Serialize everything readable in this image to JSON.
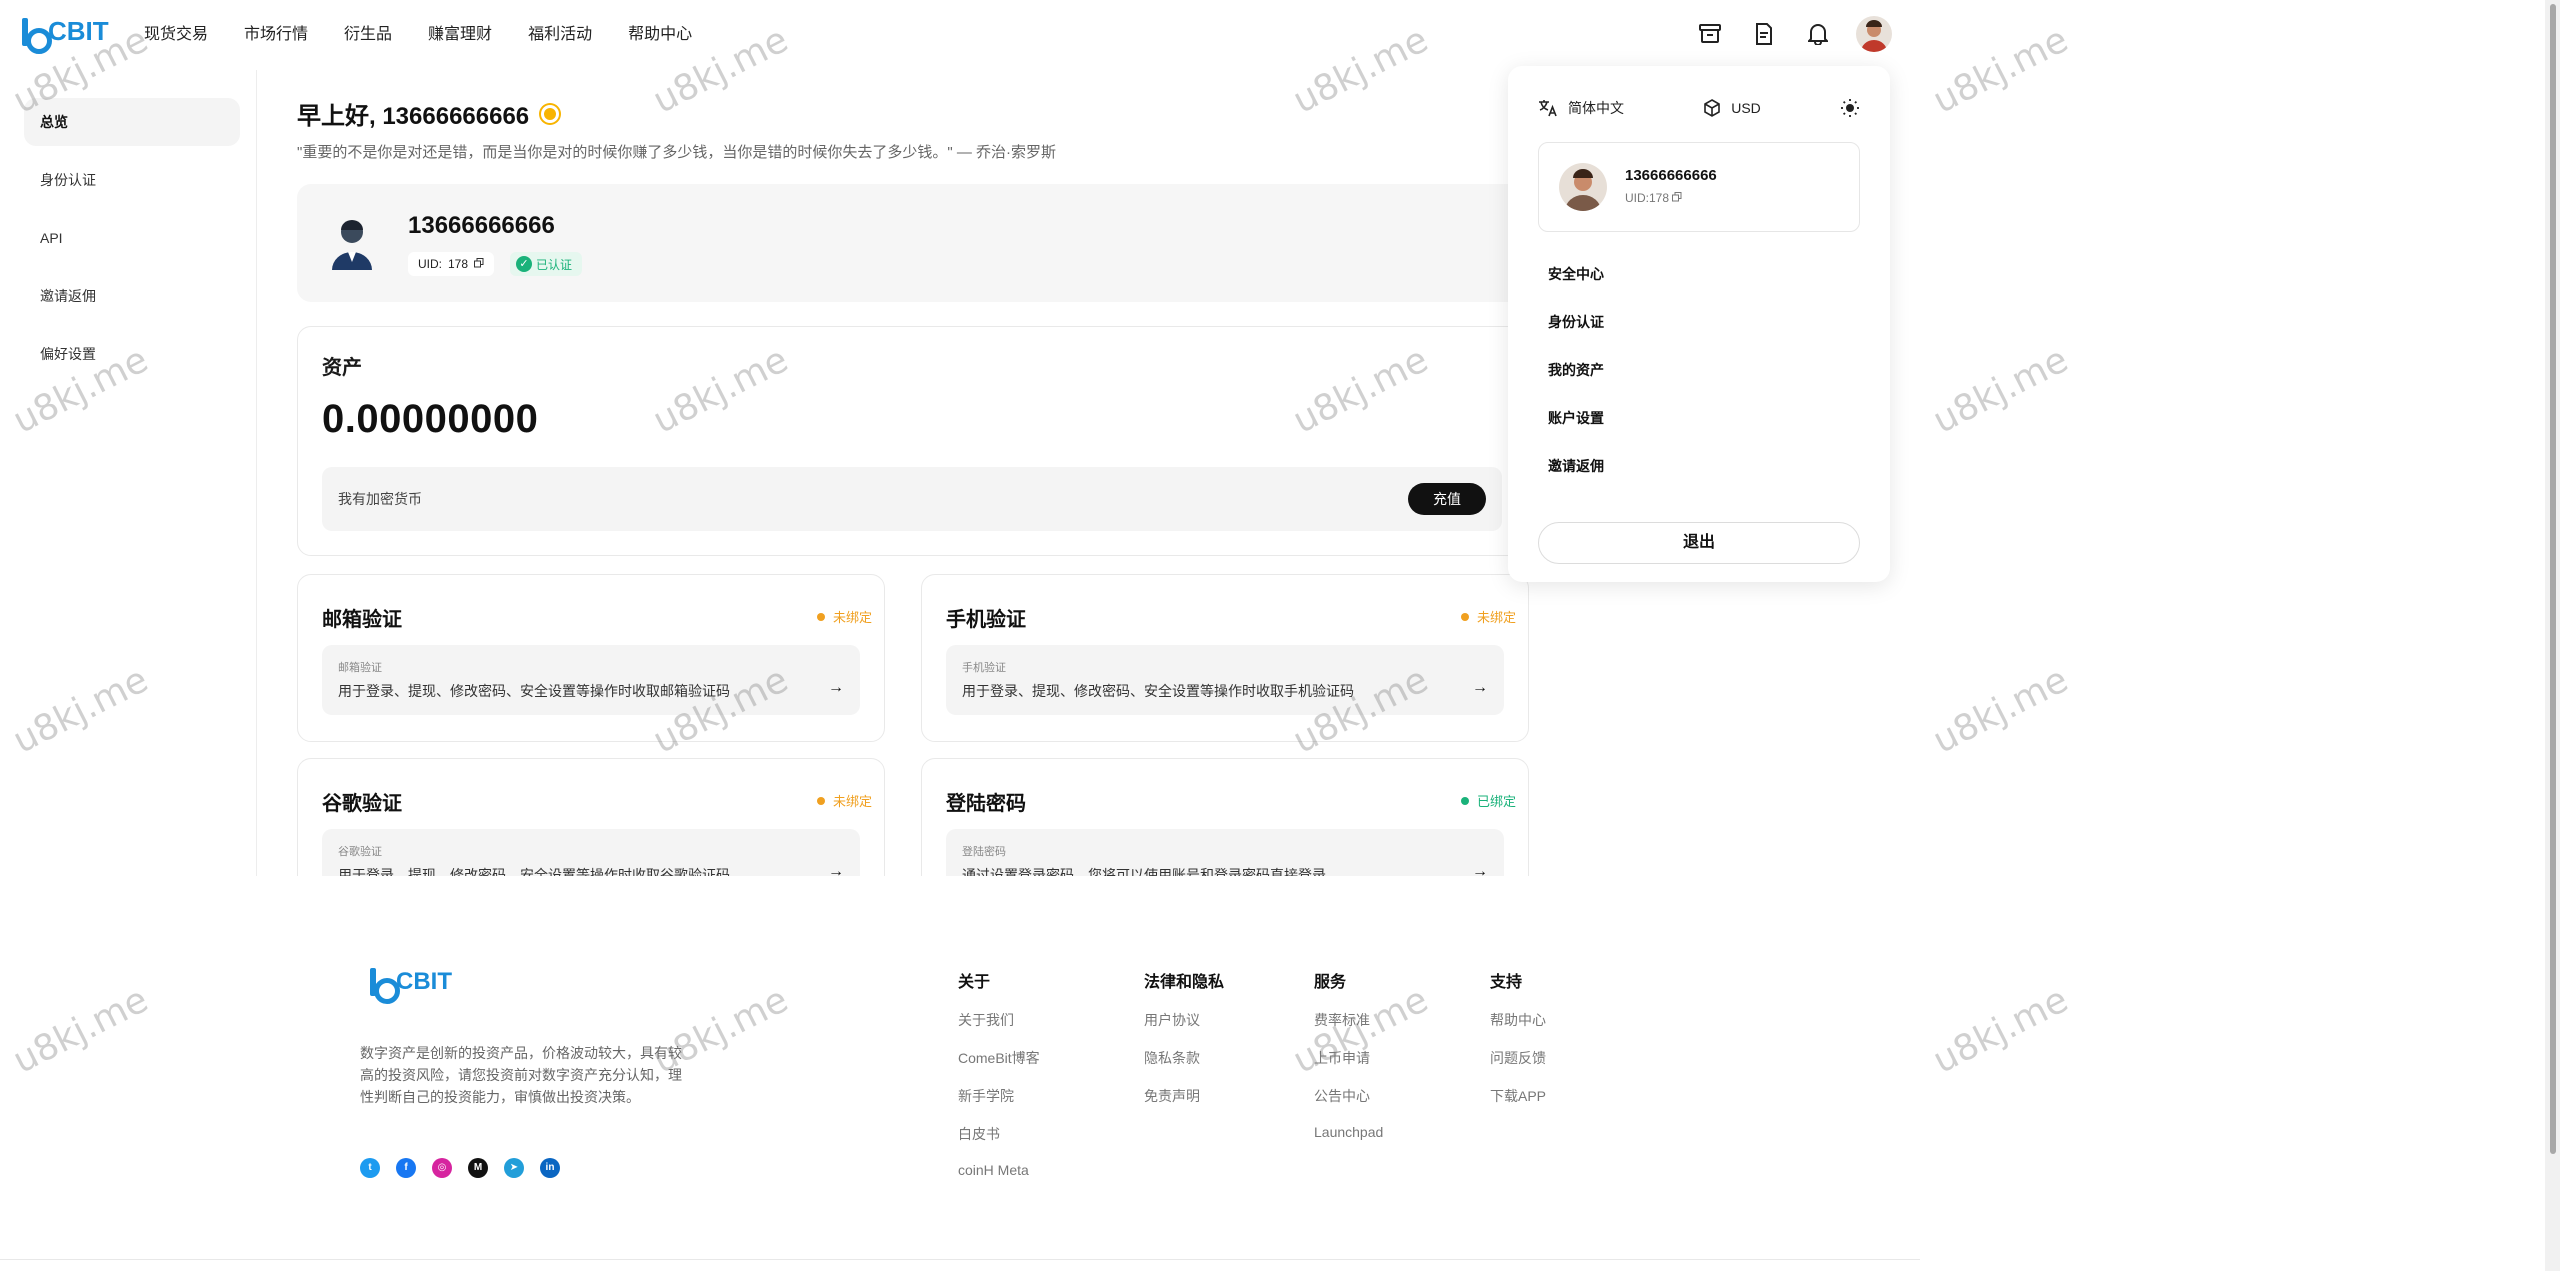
{
  "header": {
    "brand": "CBIT",
    "nav": [
      "现货交易",
      "市场行情",
      "衍生品",
      "赚富理财",
      "福利活动",
      "帮助中心"
    ],
    "icons": [
      "archive-icon",
      "document-icon",
      "bell-icon",
      "user-avatar"
    ]
  },
  "sidebar": {
    "items": [
      {
        "label": "总览",
        "active": true
      },
      {
        "label": "身份认证",
        "active": false
      },
      {
        "label": "API",
        "active": false
      },
      {
        "label": "邀请返佣",
        "active": false
      },
      {
        "label": "偏好设置",
        "active": false
      }
    ]
  },
  "main": {
    "greeting": "早上好, 13666666666",
    "quote": "\"重要的不是你是对还是错，而是当你是对的时候你赚了多少钱，当你是错的时候你失去了多少钱。\" — 乔治·索罗斯",
    "profile": {
      "name": "13666666666",
      "uid_label": "UID:",
      "uid_value": "178",
      "verified": "已认证"
    },
    "assets": {
      "title": "资产",
      "value": "0.00000000",
      "bar_text": "我有加密货币",
      "deposit": "充值"
    },
    "security": [
      {
        "title": "邮箱验证",
        "status": "未绑定",
        "status_color": "#f0a020",
        "label": "邮箱验证",
        "desc": "用于登录、提现、修改密码、安全设置等操作时收取邮箱验证码"
      },
      {
        "title": "手机验证",
        "status": "未绑定",
        "status_color": "#f0a020",
        "label": "手机验证",
        "desc": "用于登录、提现、修改密码、安全设置等操作时收取手机验证码"
      },
      {
        "title": "谷歌验证",
        "status": "未绑定",
        "status_color": "#f0a020",
        "label": "谷歌验证",
        "desc": "用于登录、提现、修改密码、安全设置等操作时收取谷歌验证码"
      },
      {
        "title": "登陆密码",
        "status": "已绑定",
        "status_color": "#1ab27a",
        "label": "登陆密码",
        "desc": "通过设置登录密码，您将可以使用账号和登录密码直接登录"
      }
    ]
  },
  "dropdown": {
    "language": "简体中文",
    "currency": "USD",
    "user_name": "13666666666",
    "user_uid": "UID:178",
    "menu": [
      "安全中心",
      "身份认证",
      "我的资产",
      "账户设置",
      "邀请返佣"
    ],
    "logout": "退出"
  },
  "footer": {
    "brand": "CBIT",
    "desc": "数字资产是创新的投资产品，价格波动较大，具有较高的投资风险，请您投资前对数字资产充分认知，理性判断自己的投资能力，审慎做出投资决策。",
    "columns": [
      {
        "title": "关于",
        "items": [
          "关于我们",
          "ComeBit博客",
          "新手学院",
          "白皮书",
          "coinH Meta"
        ]
      },
      {
        "title": "法律和隐私",
        "items": [
          "用户协议",
          "隐私条款",
          "免责声明"
        ]
      },
      {
        "title": "服务",
        "items": [
          "费率标准",
          "上币申请",
          "公告中心",
          "Launchpad"
        ]
      },
      {
        "title": "支持",
        "items": [
          "帮助中心",
          "问题反馈",
          "下载APP"
        ]
      }
    ],
    "social": [
      {
        "name": "twitter-icon",
        "glyph": "t",
        "color": "#1d9bf0"
      },
      {
        "name": "facebook-icon",
        "glyph": "f",
        "color": "#1877f2"
      },
      {
        "name": "instagram-icon",
        "glyph": "◎",
        "color": "#d6249f"
      },
      {
        "name": "medium-icon",
        "glyph": "M",
        "color": "#111111"
      },
      {
        "name": "telegram-icon",
        "glyph": "➤",
        "color": "#229ed9"
      },
      {
        "name": "linkedin-icon",
        "glyph": "in",
        "color": "#0a66c2"
      }
    ]
  },
  "watermark": "u8kj.me"
}
